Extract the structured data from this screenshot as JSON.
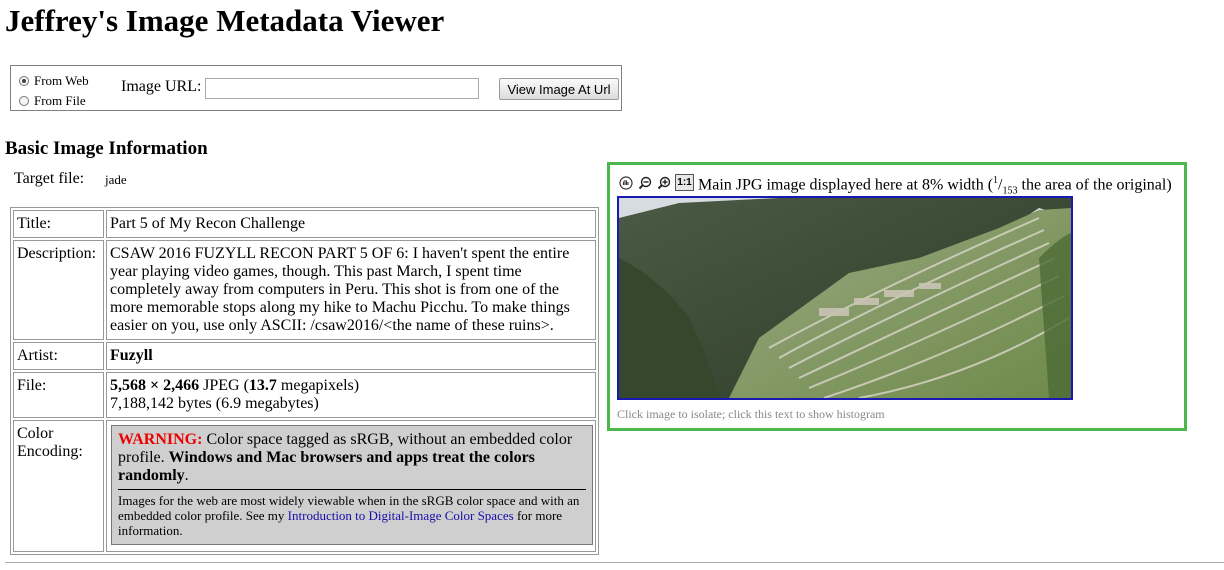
{
  "page_title": "Jeffrey's Image Metadata Viewer",
  "source_form": {
    "radio_web": "From Web",
    "radio_file": "From File",
    "selected": "From Web",
    "url_label": "Image URL:",
    "url_value": "",
    "button_label": "View Image At Url"
  },
  "basic": {
    "heading": "Basic Image Information",
    "target_label": "Target file:",
    "target_value": "jade",
    "title_label": "Title:",
    "title_value": "Part 5 of My Recon Challenge",
    "description_label": "Description:",
    "description_value": "CSAW 2016 FUZYLL RECON PART 5 OF 6: I haven't spent the entire year playing video games, though. This past March, I spent time completely away from computers in Peru. This shot is from one of the more memorable stops along my hike to Machu Picchu. To make things easier on you, use only ASCII: /csaw2016/<the name of these ruins>.",
    "artist_label": "Artist:",
    "artist_value": "Fuzyll",
    "file_label": "File:",
    "file_dims": "5,568 × 2,466",
    "file_format": "JPEG",
    "file_mp": "13.7",
    "file_mp_unit": "megapixels",
    "file_bytes": "7,188,142 bytes (6.9 megabytes)",
    "color_label_1": "Color",
    "color_label_2": "Encoding:",
    "warning_word": "WARNING:",
    "warning_text": "Color space tagged as sRGB, without an embedded color profile.",
    "warning_bold": "Windows and Mac browsers and apps treat the colors randomly",
    "warning_small_1": "Images for the web are most widely viewable when in the sRGB color space and with an embedded color profile. See my",
    "warning_link": "Introduction to Digital-Image Color Spaces",
    "warning_small_2": "for more information."
  },
  "image_panel": {
    "caption_prefix": "Main JPG image displayed here at 8% width (",
    "frac_num": "1",
    "frac_den": "153",
    "caption_suffix": " the area of the original)",
    "tool_11_label": "1:1",
    "hint": "Click image to isolate; click this text to show histogram"
  },
  "icons": [
    "hand-icon",
    "zoom-out-icon",
    "zoom-in-icon",
    "actual-size-icon"
  ],
  "colors": {
    "panel_border": "#4cb84c",
    "image_border": "#1a1ab0",
    "warning": "#e00000",
    "link": "#1a0dab"
  }
}
